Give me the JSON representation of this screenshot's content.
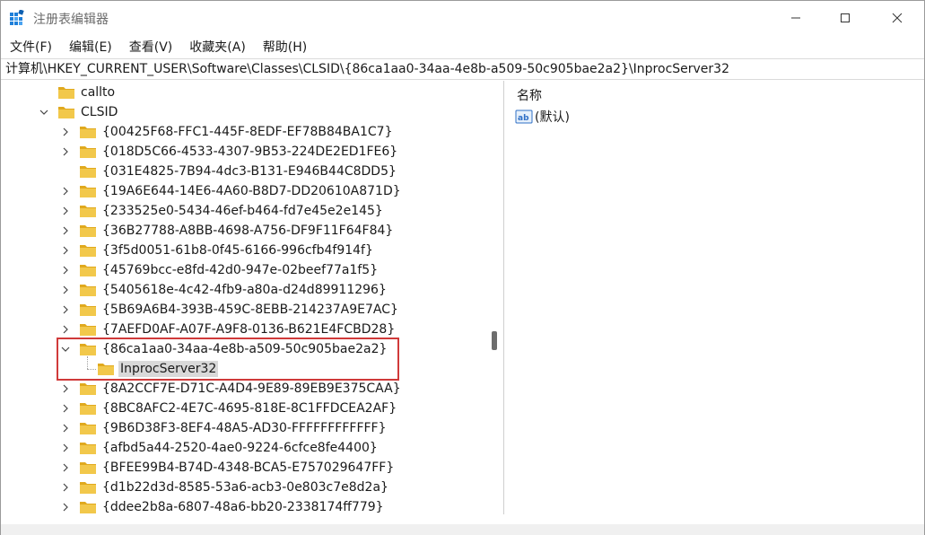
{
  "window": {
    "title": "注册表编辑器"
  },
  "menu": [
    {
      "label": "文件(F)"
    },
    {
      "label": "编辑(E)"
    },
    {
      "label": "查看(V)"
    },
    {
      "label": "收藏夹(A)"
    },
    {
      "label": "帮助(H)"
    }
  ],
  "address": {
    "path": "计算机\\HKEY_CURRENT_USER\\Software\\Classes\\CLSID\\{86ca1aa0-34aa-4e8b-a509-50c905bae2a2}\\InprocServer32"
  },
  "tree": {
    "nodes": [
      {
        "label": "callto",
        "level": 1,
        "expander": "none"
      },
      {
        "label": "CLSID",
        "level": 1,
        "expander": "expanded"
      },
      {
        "label": "{00425F68-FFC1-445F-8EDF-EF78B84BA1C7}",
        "level": 2,
        "expander": "collapsed"
      },
      {
        "label": "{018D5C66-4533-4307-9B53-224DE2ED1FE6}",
        "level": 2,
        "expander": "collapsed"
      },
      {
        "label": "{031E4825-7B94-4dc3-B131-E946B44C8DD5}",
        "level": 2,
        "expander": "none"
      },
      {
        "label": "{19A6E644-14E6-4A60-B8D7-DD20610A871D}",
        "level": 2,
        "expander": "collapsed"
      },
      {
        "label": "{233525e0-5434-46ef-b464-fd7e45e2e145}",
        "level": 2,
        "expander": "collapsed"
      },
      {
        "label": "{36B27788-A8BB-4698-A756-DF9F11F64F84}",
        "level": 2,
        "expander": "collapsed"
      },
      {
        "label": "{3f5d0051-61b8-0f45-6166-996cfb4f914f}",
        "level": 2,
        "expander": "collapsed"
      },
      {
        "label": "{45769bcc-e8fd-42d0-947e-02beef77a1f5}",
        "level": 2,
        "expander": "collapsed"
      },
      {
        "label": "{5405618e-4c42-4fb9-a80a-d24d89911296}",
        "level": 2,
        "expander": "collapsed"
      },
      {
        "label": "{5B69A6B4-393B-459C-8EBB-214237A9E7AC}",
        "level": 2,
        "expander": "collapsed"
      },
      {
        "label": "{7AEFD0AF-A07F-A9F8-0136-B621E4FCBD28}",
        "level": 2,
        "expander": "collapsed"
      },
      {
        "label": "{86ca1aa0-34aa-4e8b-a509-50c905bae2a2}",
        "level": 2,
        "expander": "expanded"
      },
      {
        "label": "InprocServer32",
        "level": 3,
        "expander": "none",
        "selected": true
      },
      {
        "label": "{8A2CCF7E-D71C-A4D4-9E89-89EB9E375CAA}",
        "level": 2,
        "expander": "collapsed"
      },
      {
        "label": "{8BC8AFC2-4E7C-4695-818E-8C1FFDCEA2AF}",
        "level": 2,
        "expander": "collapsed"
      },
      {
        "label": "{9B6D38F3-8EF4-48A5-AD30-FFFFFFFFFFFF}",
        "level": 2,
        "expander": "collapsed"
      },
      {
        "label": "{afbd5a44-2520-4ae0-9224-6cfce8fe4400}",
        "level": 2,
        "expander": "collapsed"
      },
      {
        "label": "{BFEE99B4-B74D-4348-BCA5-E757029647FF}",
        "level": 2,
        "expander": "collapsed"
      },
      {
        "label": "{d1b22d3d-8585-53a6-acb3-0e803c7e8d2a}",
        "level": 2,
        "expander": "collapsed"
      },
      {
        "label": "{ddee2b8a-6807-48a6-bb20-2338174ff779}",
        "level": 2,
        "expander": "collapsed"
      }
    ]
  },
  "values": {
    "column_name": "名称",
    "rows": [
      {
        "name": "(默认)",
        "icon": "string-value-icon"
      }
    ]
  },
  "colors": {
    "folder": "#f2c84b",
    "folder_dark": "#e0a91e",
    "selection": "#d9d9d9",
    "annotation_box": "#d03a3a",
    "app_icon": "#1e7fd9"
  }
}
